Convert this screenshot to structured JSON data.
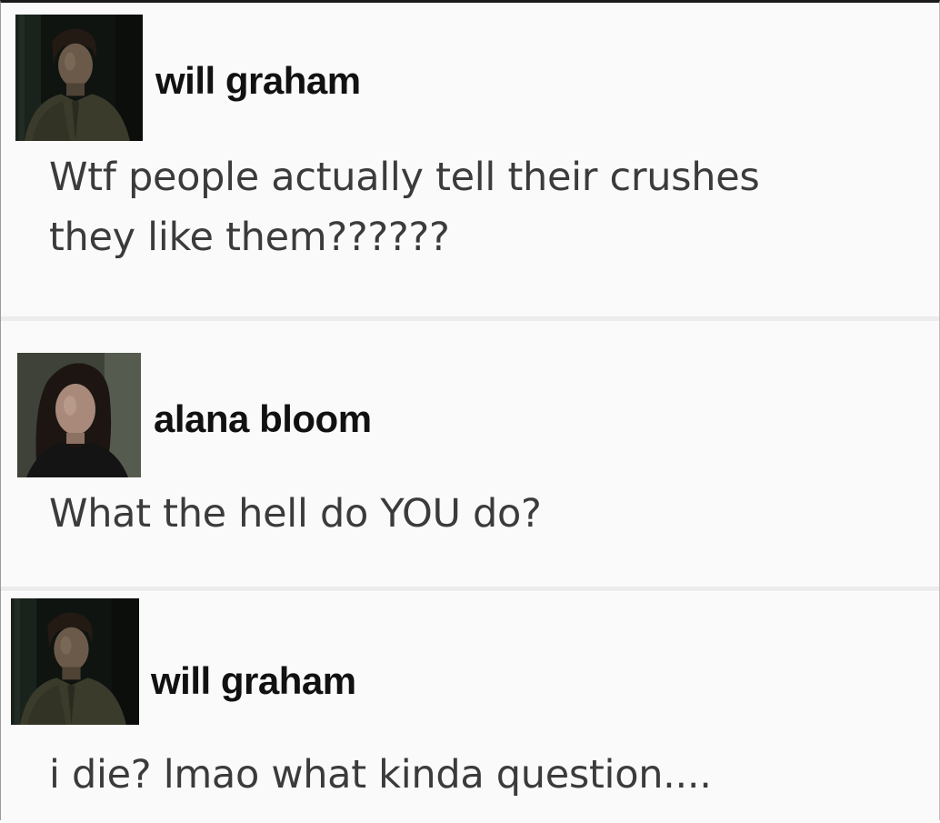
{
  "posts": [
    {
      "username": "will graham",
      "avatar_icon": "profile-photo-man-dark",
      "message": "Wtf people actually tell their crushes\nthey like them??????"
    },
    {
      "username": "alana bloom",
      "avatar_icon": "profile-photo-woman-dark-hair",
      "message": "What the hell do YOU do?"
    },
    {
      "username": "will graham",
      "avatar_icon": "profile-photo-man-dark",
      "message": "i die? lmao what kinda question...."
    }
  ],
  "colors": {
    "background": "#fafafa",
    "username": "#111111",
    "message": "#3b3b3b",
    "separator": "#ececec"
  }
}
